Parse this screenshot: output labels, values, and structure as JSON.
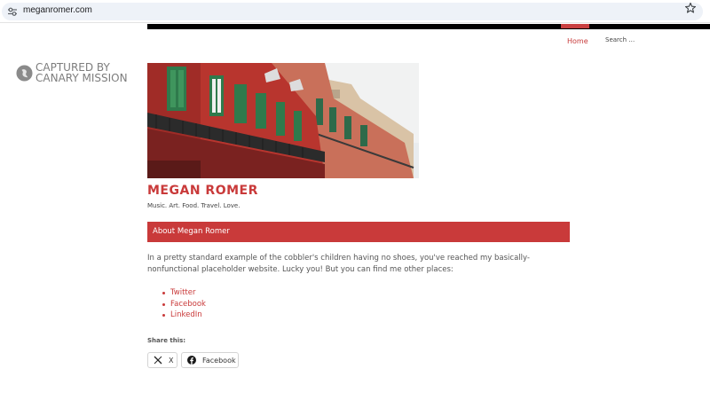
{
  "browser": {
    "url": "meganromer.com",
    "site_info_icon": "tune-icon",
    "bookmark_icon": "star-icon"
  },
  "nav": {
    "home_label": "Home",
    "search_placeholder": "Search …"
  },
  "badge": {
    "line1": "CAPTURED BY",
    "line2": "CANARY MISSION",
    "icon": "canary-mission-logo"
  },
  "site": {
    "title": "MEGAN ROMER",
    "tagline": "Music. Art. Food. Travel. Love.",
    "accent_color": "#c93a3a"
  },
  "page": {
    "heading": "About Megan Romer",
    "paragraph": "In a pretty standard example of the cobbler's children having no shoes, you've reached my basically-nonfunctional placeholder website. Lucky you! But you can find me other places:",
    "links": [
      {
        "label": "Twitter"
      },
      {
        "label": "Facebook"
      },
      {
        "label": "LinkedIn"
      }
    ]
  },
  "share": {
    "heading": "Share this:",
    "buttons": [
      {
        "label": "X",
        "icon": "x-icon"
      },
      {
        "label": "Facebook",
        "icon": "facebook-icon"
      }
    ]
  }
}
